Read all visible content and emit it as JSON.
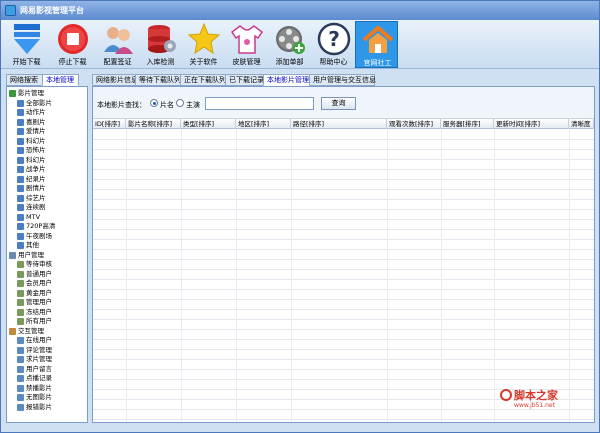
{
  "window": {
    "title": "网易影视管理平台"
  },
  "toolbar": [
    {
      "label": "开始下载",
      "icon": "start-download-icon"
    },
    {
      "label": "停止下载",
      "icon": "stop-download-icon"
    },
    {
      "label": "配置签证",
      "icon": "config-users-icon"
    },
    {
      "label": "入库检测",
      "icon": "database-check-icon"
    },
    {
      "label": "关于软件",
      "icon": "star-about-icon"
    },
    {
      "label": "皮肤管理",
      "icon": "shirt-skin-icon"
    },
    {
      "label": "添加单部",
      "icon": "film-reel-icon"
    },
    {
      "label": "帮助中心",
      "icon": "help-icon"
    },
    {
      "label": "官网社工",
      "icon": "home-icon"
    }
  ],
  "left_tabs": [
    "网络搜索",
    "本地管理"
  ],
  "main_tabs": [
    "网络影片信息",
    "等待下载队列",
    "正在下载队列",
    "已下载记录",
    "本地影片管理",
    "用户管理与交互信息"
  ],
  "tree": [
    {
      "label": "影片管理",
      "level": 0,
      "color": "#3a9a3a"
    },
    {
      "label": "全部影片",
      "level": 1,
      "color": "#4a7fc8"
    },
    {
      "label": "动作片",
      "level": 1,
      "color": "#4a7fc8"
    },
    {
      "label": "喜剧片",
      "level": 1,
      "color": "#4a7fc8"
    },
    {
      "label": "爱情片",
      "level": 1,
      "color": "#4a7fc8"
    },
    {
      "label": "科幻片",
      "level": 1,
      "color": "#4a7fc8"
    },
    {
      "label": "恐怖片",
      "level": 1,
      "color": "#4a7fc8"
    },
    {
      "label": "科幻片",
      "level": 1,
      "color": "#4a7fc8"
    },
    {
      "label": "战争片",
      "level": 1,
      "color": "#4a7fc8"
    },
    {
      "label": "纪录片",
      "level": 1,
      "color": "#4a7fc8"
    },
    {
      "label": "剧情片",
      "level": 1,
      "color": "#4a7fc8"
    },
    {
      "label": "综艺片",
      "level": 1,
      "color": "#4a7fc8"
    },
    {
      "label": "连续剧",
      "level": 1,
      "color": "#4a7fc8"
    },
    {
      "label": "MTV",
      "level": 1,
      "color": "#4a7fc8"
    },
    {
      "label": "720P高清",
      "level": 1,
      "color": "#4a7fc8"
    },
    {
      "label": "午夜剧场",
      "level": 1,
      "color": "#4a7fc8"
    },
    {
      "label": "其他",
      "level": 1,
      "color": "#4a7fc8"
    },
    {
      "label": "用户管理",
      "level": 0,
      "color": "#6a8ab0"
    },
    {
      "label": "等待审核",
      "level": 1,
      "color": "#7a9a5a"
    },
    {
      "label": "普通用户",
      "level": 1,
      "color": "#7a9a5a"
    },
    {
      "label": "会员用户",
      "level": 1,
      "color": "#7a9a5a"
    },
    {
      "label": "黄金用户",
      "level": 1,
      "color": "#7a9a5a"
    },
    {
      "label": "管理用户",
      "level": 1,
      "color": "#7a9a5a"
    },
    {
      "label": "冻结用户",
      "level": 1,
      "color": "#7a9a5a"
    },
    {
      "label": "所有用户",
      "level": 1,
      "color": "#7a9a5a"
    },
    {
      "label": "交互管理",
      "level": 0,
      "color": "#c08a3a"
    },
    {
      "label": "在线用户",
      "level": 1,
      "color": "#5a8ac0"
    },
    {
      "label": "评论管理",
      "level": 1,
      "color": "#5a8ac0"
    },
    {
      "label": "求片管理",
      "level": 1,
      "color": "#5a8ac0"
    },
    {
      "label": "用户留言",
      "level": 1,
      "color": "#5a8ac0"
    },
    {
      "label": "点播记录",
      "level": 1,
      "color": "#5a8ac0"
    },
    {
      "label": "禁播影片",
      "level": 1,
      "color": "#5a8ac0"
    },
    {
      "label": "无图影片",
      "level": 1,
      "color": "#5a8ac0"
    },
    {
      "label": "报错影片",
      "level": 1,
      "color": "#5a8ac0"
    }
  ],
  "search": {
    "label": "本地影片查找：",
    "options": [
      "片名",
      "主演"
    ],
    "selected": "片名",
    "value": "",
    "button": "查询"
  },
  "grid_columns": [
    "ID[排序]",
    "影片名称[排序]",
    "类型[排序]",
    "地区[排序]",
    "路径[排序]",
    "观看次数[排序]",
    "服务器[排序]",
    "更新时间[排序]",
    "清晰度"
  ],
  "watermark": {
    "text": "脚本之家",
    "sub": "www.jb51.net"
  }
}
